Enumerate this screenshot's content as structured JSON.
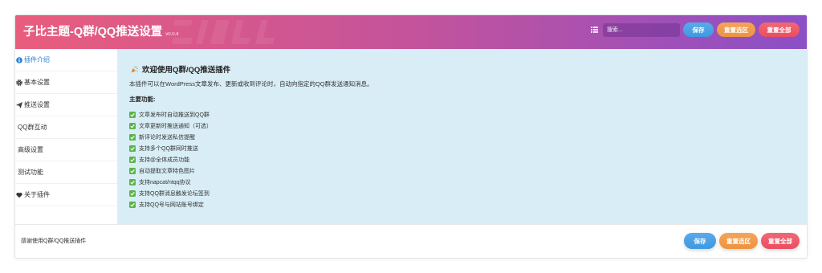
{
  "header": {
    "title": "子比主题-Q群/QQ推送设置",
    "version": "v0.0.4",
    "list_icon": "list-icon",
    "search": {
      "placeholder": "搜索..."
    },
    "buttons": {
      "save": "保存",
      "reset_section": "重置选区",
      "reset_all": "重置全部"
    }
  },
  "sidebar": {
    "items": [
      {
        "label": "插件介绍",
        "icon": "info-circle-icon",
        "active": true
      },
      {
        "label": "基本设置",
        "icon": "gear-icon",
        "active": false
      },
      {
        "label": "推送设置",
        "icon": "paper-plane-icon",
        "active": false
      },
      {
        "label": "QQ群互动",
        "active": false
      },
      {
        "label": "高级设置",
        "active": false
      },
      {
        "label": "测试功能",
        "active": false
      },
      {
        "label": "关于插件",
        "icon": "heart-icon",
        "active": false
      }
    ]
  },
  "content": {
    "heading_icon": "party-popper-icon",
    "heading": "欢迎使用Q群/QQ推送插件",
    "intro": "本插件可以在WordPress文章发布、更新或收到评论时，自动向指定的QQ群发送通知消息。",
    "features_title": "主要功能:",
    "feature_icon": "check-box-icon",
    "features": [
      "文章发布时自动推送到QQ群",
      "文章更新时推送通知（可选）",
      "新评论时发送私信提醒",
      "支持多个QQ群同时推送",
      "支持@全体成员功能",
      "自动提取文章特色图片",
      "支持napcat/ntqq协议",
      "支持QQ群消息触发论坛签到",
      "支持QQ号与网站账号绑定"
    ]
  },
  "footer": {
    "text": "感谢使用Q群/QQ推送插件",
    "buttons": {
      "save": "保存",
      "reset_section": "重置选区",
      "reset_all": "重置全部"
    }
  },
  "colors": {
    "header_gradient": [
      "#e95d7d",
      "#c4539b",
      "#8b4fc7"
    ],
    "content_bg": "#d8edf5",
    "active_link": "#2a7fd4",
    "save_button": "#3f9ce6",
    "reset_section_button": "#f29640",
    "reset_all_button": "#ef4f61",
    "check_green": "#5bb44a"
  }
}
